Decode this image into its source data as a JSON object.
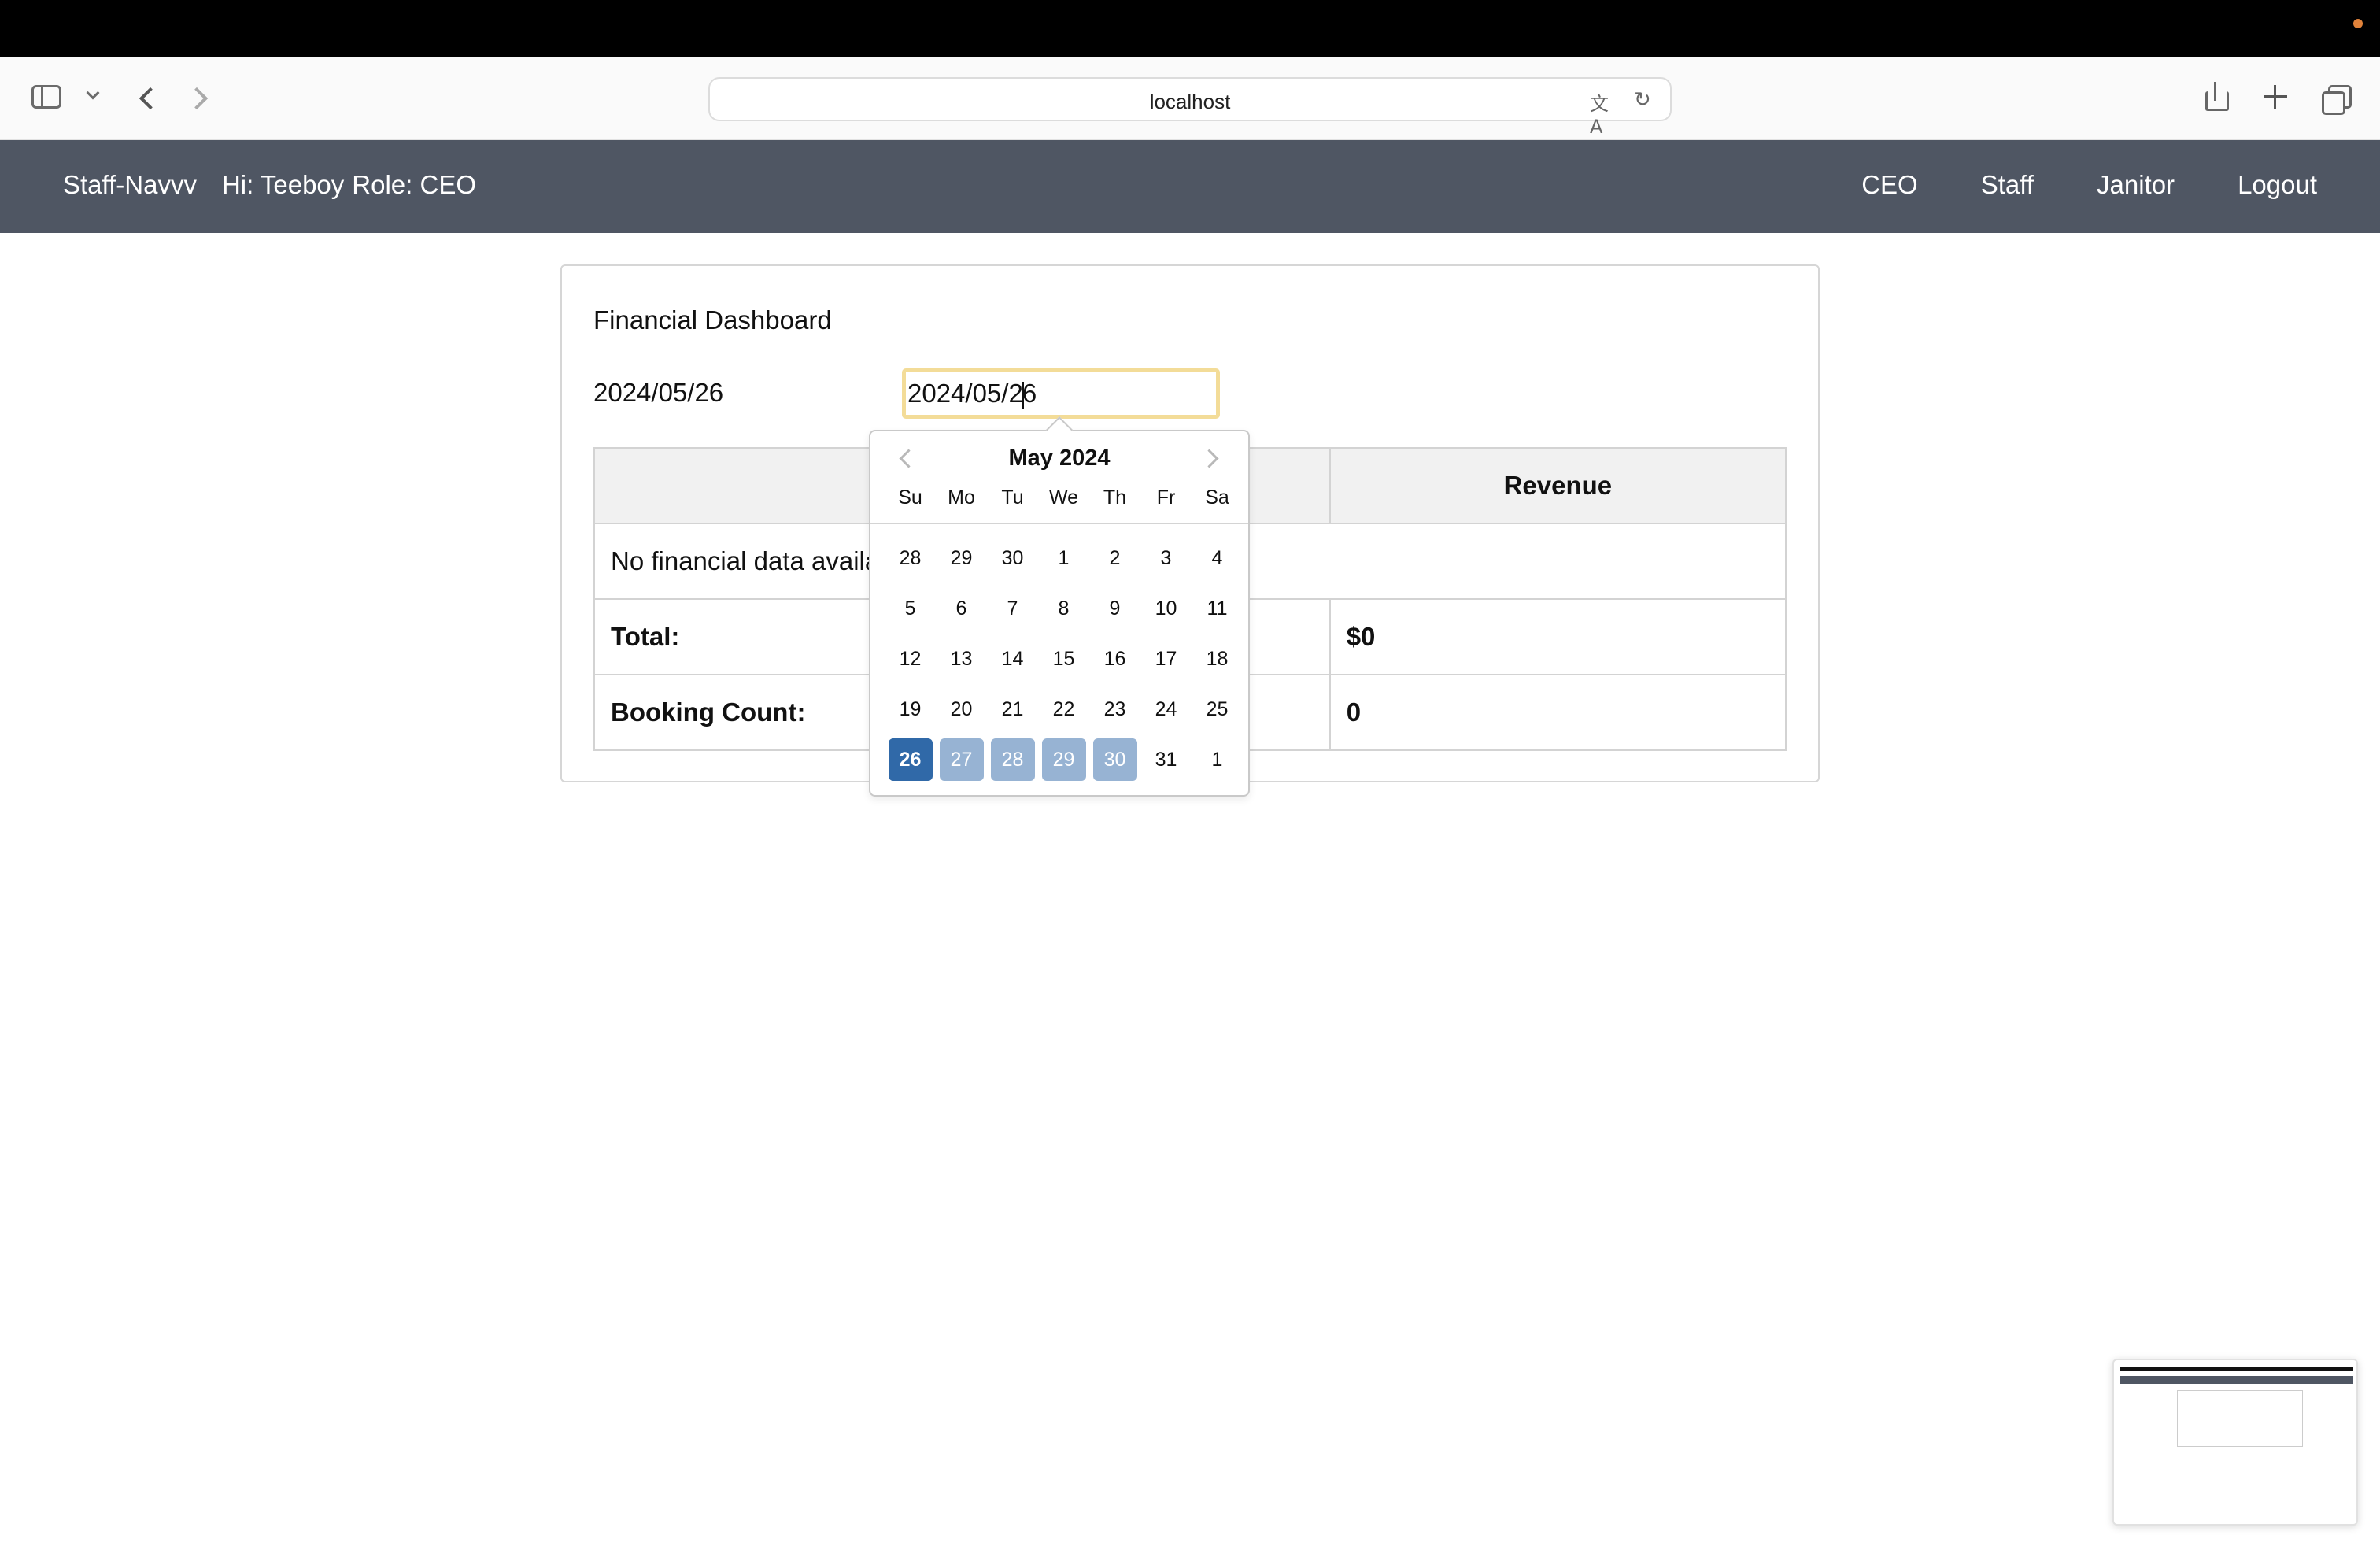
{
  "browser": {
    "url": "localhost"
  },
  "navbar": {
    "brand": "Staff-Navvv",
    "greeting": "Hi: Teeboy",
    "role": "Role: CEO",
    "links": [
      "CEO",
      "Staff",
      "Janitor",
      "Logout"
    ]
  },
  "dashboard": {
    "title": "Financial Dashboard",
    "selected_date_label": "2024/05/26",
    "date_input_before_caret": "2024/05/2",
    "date_input_after_caret": "6",
    "table": {
      "header_revenue": "Revenue",
      "no_data_text": "No financial data availa",
      "total_label": "Total:",
      "total_value": "$0",
      "booking_label": "Booking Count:",
      "booking_value": "0"
    }
  },
  "datepicker": {
    "title": "May 2024",
    "weekdays": [
      "Su",
      "Mo",
      "Tu",
      "We",
      "Th",
      "Fr",
      "Sa"
    ],
    "days": [
      {
        "d": "28",
        "s": ""
      },
      {
        "d": "29",
        "s": ""
      },
      {
        "d": "30",
        "s": ""
      },
      {
        "d": "1",
        "s": ""
      },
      {
        "d": "2",
        "s": ""
      },
      {
        "d": "3",
        "s": ""
      },
      {
        "d": "4",
        "s": ""
      },
      {
        "d": "5",
        "s": ""
      },
      {
        "d": "6",
        "s": ""
      },
      {
        "d": "7",
        "s": ""
      },
      {
        "d": "8",
        "s": ""
      },
      {
        "d": "9",
        "s": ""
      },
      {
        "d": "10",
        "s": ""
      },
      {
        "d": "11",
        "s": ""
      },
      {
        "d": "12",
        "s": ""
      },
      {
        "d": "13",
        "s": ""
      },
      {
        "d": "14",
        "s": ""
      },
      {
        "d": "15",
        "s": ""
      },
      {
        "d": "16",
        "s": ""
      },
      {
        "d": "17",
        "s": ""
      },
      {
        "d": "18",
        "s": ""
      },
      {
        "d": "19",
        "s": ""
      },
      {
        "d": "20",
        "s": ""
      },
      {
        "d": "21",
        "s": ""
      },
      {
        "d": "22",
        "s": ""
      },
      {
        "d": "23",
        "s": ""
      },
      {
        "d": "24",
        "s": ""
      },
      {
        "d": "25",
        "s": ""
      },
      {
        "d": "26",
        "s": "active"
      },
      {
        "d": "27",
        "s": "range"
      },
      {
        "d": "28",
        "s": "range"
      },
      {
        "d": "29",
        "s": "range"
      },
      {
        "d": "30",
        "s": "range"
      },
      {
        "d": "31",
        "s": ""
      },
      {
        "d": "1",
        "s": ""
      }
    ],
    "colors": {
      "active": "#3069a8",
      "range": "#97b3d3"
    }
  },
  "icons": {
    "sidebar": "sidebar-icon",
    "back": "chevron-left-icon",
    "forward": "chevron-right-icon",
    "translate": "translate-icon",
    "reload": "reload-icon",
    "share": "share-icon",
    "new_tab": "plus-icon",
    "tab_overview": "tabs-icon"
  },
  "colors": {
    "navbar_bg": "#4f5663",
    "input_focus_border": "#f3dc98"
  }
}
